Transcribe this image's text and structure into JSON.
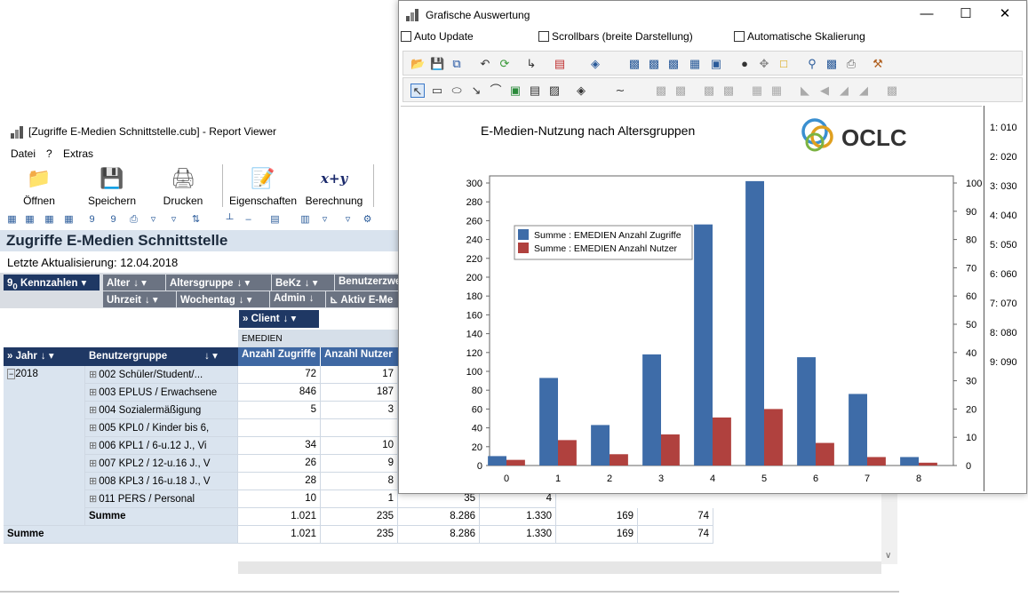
{
  "report_viewer": {
    "title": "[Zugriffe E-Medien Schnittstelle.cub] - Report Viewer",
    "menu": [
      "Datei",
      "?",
      "Extras"
    ],
    "toolbar": [
      "Öffnen",
      "Speichern",
      "Drucken",
      "Eigenschaften",
      "Berechnung"
    ],
    "report_title": "Zugriffe E-Medien Schnittstelle",
    "last_update": "Letzte Aktualisierung:  12.04.2018",
    "kennzahlen": "Kennzahlen",
    "filter_fields_row1": [
      "Alter",
      "Altersgruppe",
      "BeKz",
      "Benutzerzwe"
    ],
    "filter_fields_row2": [
      "Uhrzeit",
      "Wochentag",
      "Admin",
      "Aktiv E-Me"
    ],
    "col_field": "Client",
    "col_value": "EMEDIEN",
    "row_fields": [
      "Jahr",
      "Benutzergruppe"
    ],
    "measure_headers": [
      "Anzahl Zugriffe",
      "Anzahl Nutzer"
    ],
    "year": "2018",
    "rows": [
      {
        "label": "002 Schüler/Student/...",
        "zugriffe": "72",
        "nutzer": "17"
      },
      {
        "label": "003 EPLUS / Erwachsene",
        "zugriffe": "846",
        "nutzer": "187"
      },
      {
        "label": "004 Sozialermäßigung",
        "zugriffe": "5",
        "nutzer": "3"
      },
      {
        "label": "005 KPL0 / Kinder bis 6,",
        "zugriffe": "",
        "nutzer": ""
      },
      {
        "label": "006 KPL1 / 6-u.12 J., Vi",
        "zugriffe": "34",
        "nutzer": "10"
      },
      {
        "label": "007 KPL2 / 12-u.16 J., V",
        "zugriffe": "26",
        "nutzer": "9"
      },
      {
        "label": "008 KPL3 / 16-u.18 J., V",
        "zugriffe": "28",
        "nutzer": "8"
      },
      {
        "label": "011 PERS / Personal",
        "zugriffe": "10",
        "nutzer": "1",
        "extra": [
          "35",
          "4"
        ]
      }
    ],
    "subtotal": {
      "label": "Summe",
      "values": [
        "1.021",
        "235",
        "8.286",
        "1.330",
        "169",
        "74"
      ]
    },
    "total": {
      "label": "Summe",
      "values": [
        "1.021",
        "235",
        "8.286",
        "1.330",
        "169",
        "74"
      ]
    }
  },
  "graph_window": {
    "title": "Grafische Auswertung",
    "checkboxes": [
      "Auto Update",
      "Scrollbars (breite Darstellung)",
      "Automatische Skalierung"
    ],
    "logo": "OCLC",
    "side_labels": [
      "1: 010",
      "2: 020",
      "3: 030",
      "4: 040",
      "5: 050",
      "6: 060",
      "7: 070",
      "8: 080",
      "9: 090"
    ]
  },
  "chart_data": {
    "type": "bar",
    "title": "E-Medien-Nutzung nach Altersgruppen",
    "categories": [
      "0",
      "1",
      "2",
      "3",
      "4",
      "5",
      "6",
      "7",
      "8"
    ],
    "series": [
      {
        "name": "Summe : EMEDIEN Anzahl Zugriffe",
        "axis": "left",
        "color": "#3e6ca8",
        "values": [
          10,
          93,
          43,
          118,
          256,
          302,
          115,
          76,
          9
        ]
      },
      {
        "name": "Summe : EMEDIEN Anzahl Nutzer",
        "axis": "right",
        "color": "#b0413e",
        "values": [
          2,
          9,
          4,
          11,
          17,
          20,
          8,
          3,
          1
        ]
      }
    ],
    "ylim_left": [
      0,
      300
    ],
    "yticks_left": [
      0,
      20,
      40,
      60,
      80,
      100,
      120,
      140,
      160,
      180,
      200,
      220,
      240,
      260,
      280,
      300
    ],
    "ylim_right": [
      0,
      100
    ],
    "yticks_right": [
      0,
      10,
      20,
      30,
      40,
      50,
      60,
      70,
      80,
      90,
      100
    ],
    "legend": "upper-left",
    "grid": false
  }
}
